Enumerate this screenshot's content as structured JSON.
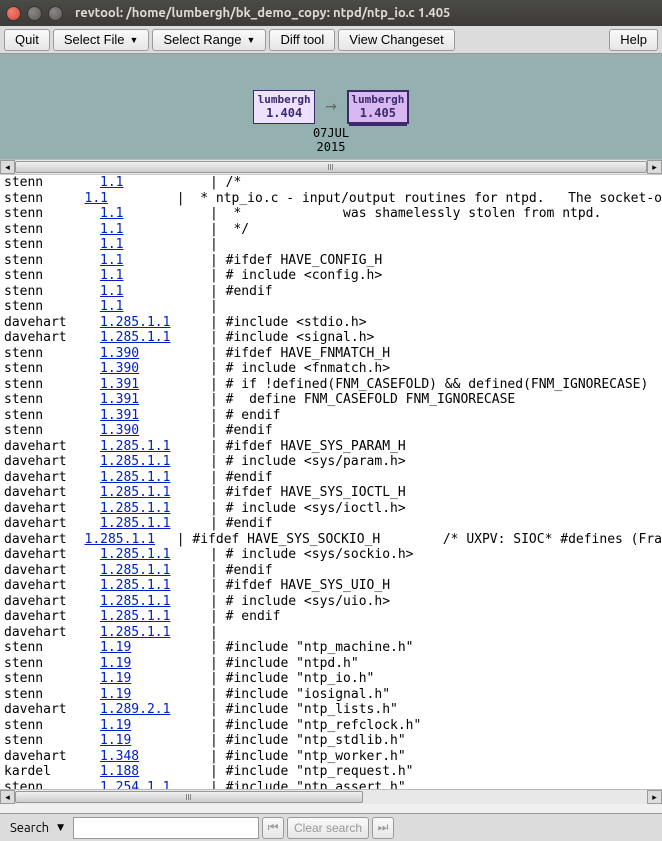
{
  "window": {
    "title": "revtool: /home/lumbergh/bk_demo_copy: ntpd/ntp_io.c 1.405"
  },
  "toolbar": {
    "quit": "Quit",
    "select_file": "Select File",
    "select_range": "Select Range",
    "diff_tool": "Diff tool",
    "view_changeset": "View Changeset",
    "help": "Help"
  },
  "graph": {
    "left": {
      "user": "lumbergh",
      "rev": "1.404"
    },
    "right": {
      "user": "lumbergh",
      "rev": "1.405"
    },
    "date_line1": "07JUL",
    "date_line2": "2015"
  },
  "code": {
    "lines": [
      {
        "author": "stenn",
        "rev": "1.1",
        "text": "/*"
      },
      {
        "author": "stenn",
        "rev": "1.1",
        "text": " * ntp_io.c - input/output routines for ntpd.   The socket-o"
      },
      {
        "author": "stenn",
        "rev": "1.1",
        "text": " *             was shamelessly stolen from ntpd."
      },
      {
        "author": "stenn",
        "rev": "1.1",
        "text": " */"
      },
      {
        "author": "stenn",
        "rev": "1.1",
        "text": ""
      },
      {
        "author": "stenn",
        "rev": "1.1",
        "text": "#ifdef HAVE_CONFIG_H"
      },
      {
        "author": "stenn",
        "rev": "1.1",
        "text": "# include <config.h>"
      },
      {
        "author": "stenn",
        "rev": "1.1",
        "text": "#endif"
      },
      {
        "author": "stenn",
        "rev": "1.1",
        "text": ""
      },
      {
        "author": "davehart",
        "rev": "1.285.1.1",
        "text": "#include <stdio.h>"
      },
      {
        "author": "davehart",
        "rev": "1.285.1.1",
        "text": "#include <signal.h>"
      },
      {
        "author": "stenn",
        "rev": "1.390",
        "text": "#ifdef HAVE_FNMATCH_H"
      },
      {
        "author": "stenn",
        "rev": "1.390",
        "text": "# include <fnmatch.h>"
      },
      {
        "author": "stenn",
        "rev": "1.391",
        "text": "# if !defined(FNM_CASEFOLD) && defined(FNM_IGNORECASE)"
      },
      {
        "author": "stenn",
        "rev": "1.391",
        "text": "#  define FNM_CASEFOLD FNM_IGNORECASE"
      },
      {
        "author": "stenn",
        "rev": "1.391",
        "text": "# endif"
      },
      {
        "author": "stenn",
        "rev": "1.390",
        "text": "#endif"
      },
      {
        "author": "davehart",
        "rev": "1.285.1.1",
        "text": "#ifdef HAVE_SYS_PARAM_H"
      },
      {
        "author": "davehart",
        "rev": "1.285.1.1",
        "text": "# include <sys/param.h>"
      },
      {
        "author": "davehart",
        "rev": "1.285.1.1",
        "text": "#endif"
      },
      {
        "author": "davehart",
        "rev": "1.285.1.1",
        "text": "#ifdef HAVE_SYS_IOCTL_H"
      },
      {
        "author": "davehart",
        "rev": "1.285.1.1",
        "text": "# include <sys/ioctl.h>"
      },
      {
        "author": "davehart",
        "rev": "1.285.1.1",
        "text": "#endif"
      },
      {
        "author": "davehart",
        "rev": "1.285.1.1",
        "text": "#ifdef HAVE_SYS_SOCKIO_H        /* UXPV: SIOC* #defines (Fra"
      },
      {
        "author": "davehart",
        "rev": "1.285.1.1",
        "text": "# include <sys/sockio.h>"
      },
      {
        "author": "davehart",
        "rev": "1.285.1.1",
        "text": "#endif"
      },
      {
        "author": "davehart",
        "rev": "1.285.1.1",
        "text": "#ifdef HAVE_SYS_UIO_H"
      },
      {
        "author": "davehart",
        "rev": "1.285.1.1",
        "text": "# include <sys/uio.h>"
      },
      {
        "author": "davehart",
        "rev": "1.285.1.1",
        "text": "# endif"
      },
      {
        "author": "davehart",
        "rev": "1.285.1.1",
        "text": ""
      },
      {
        "author": "stenn",
        "rev": "1.19",
        "text": "#include \"ntp_machine.h\""
      },
      {
        "author": "stenn",
        "rev": "1.19",
        "text": "#include \"ntpd.h\""
      },
      {
        "author": "stenn",
        "rev": "1.19",
        "text": "#include \"ntp_io.h\""
      },
      {
        "author": "stenn",
        "rev": "1.19",
        "text": "#include \"iosignal.h\""
      },
      {
        "author": "davehart",
        "rev": "1.289.2.1",
        "text": "#include \"ntp_lists.h\""
      },
      {
        "author": "stenn",
        "rev": "1.19",
        "text": "#include \"ntp_refclock.h\""
      },
      {
        "author": "stenn",
        "rev": "1.19",
        "text": "#include \"ntp_stdlib.h\""
      },
      {
        "author": "davehart",
        "rev": "1.348",
        "text": "#include \"ntp_worker.h\""
      },
      {
        "author": "kardel",
        "rev": "1.188",
        "text": "#include \"ntp_request.h\""
      },
      {
        "author": "stenn",
        "rev": "1.254.1.1",
        "text": "#include \"ntp_assert.h\""
      }
    ]
  },
  "search": {
    "label": "Search",
    "value": "",
    "placeholder": "",
    "clear": "Clear search",
    "prev_icon": "⏮",
    "next_icon": "⏭"
  }
}
